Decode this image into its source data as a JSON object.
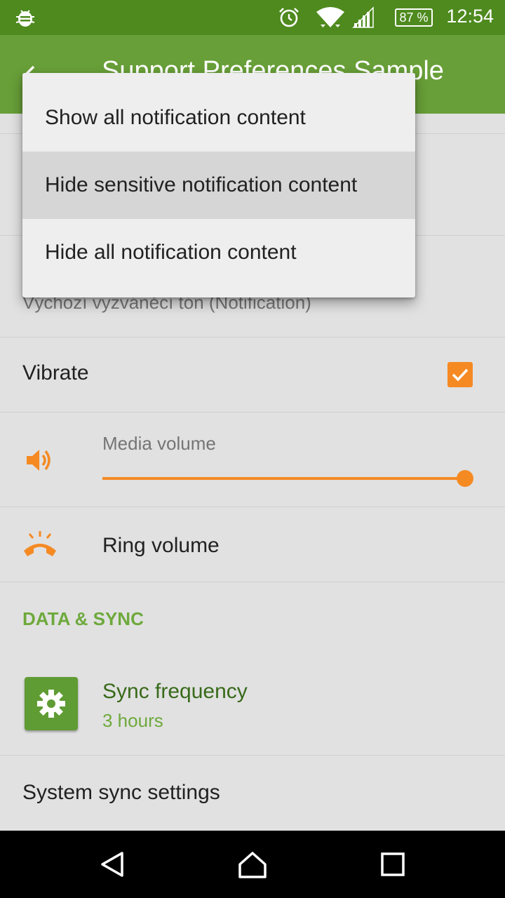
{
  "status_bar": {
    "battery_percent": "87 %",
    "time": "12:54",
    "icons": [
      "debug-bug-icon",
      "alarm-icon",
      "wifi-icon",
      "cell-signal-icon",
      "battery-icon"
    ]
  },
  "app_bar": {
    "title": "Support Preferences Sample",
    "back_icon": "back-arrow-icon"
  },
  "preferences": {
    "notification_summary": "Výchozí vyzváněcí tón (Notification)",
    "vibrate": {
      "title": "Vibrate",
      "checked": true
    },
    "media_volume": {
      "title": "Media volume",
      "icon": "speaker-icon",
      "level": 1.0
    },
    "ring_volume": {
      "title": "Ring volume",
      "icon": "ringing-phone-icon"
    },
    "data_sync_header": "DATA & SYNC",
    "sync_frequency": {
      "title": "Sync frequency",
      "summary": "3 hours",
      "icon": "gear-icon"
    },
    "system_sync": {
      "title": "System sync settings"
    }
  },
  "popup_menu": {
    "items": [
      {
        "label": "Show all notification content",
        "selected": false
      },
      {
        "label": "Hide sensitive notification content",
        "selected": true
      },
      {
        "label": "Hide all notification content",
        "selected": false
      }
    ]
  },
  "nav_bar": {
    "buttons": [
      "back-triangle-icon",
      "home-icon",
      "recents-square-icon"
    ]
  },
  "colors": {
    "status_bar": "#4e8a1e",
    "app_bar": "#689f38",
    "accent": "#f58a23",
    "section_header": "#6ea93c"
  }
}
